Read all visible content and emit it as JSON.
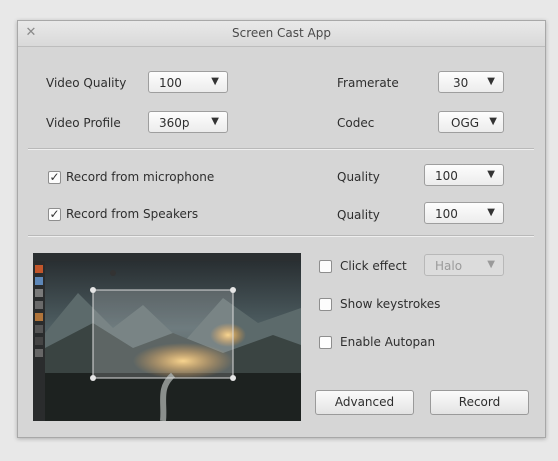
{
  "window": {
    "title": "Screen Cast App"
  },
  "video": {
    "quality_label": "Video Quality",
    "quality_value": "100",
    "profile_label": "Video Profile",
    "profile_value": "360p",
    "framerate_label": "Framerate",
    "framerate_value": "30",
    "codec_label": "Codec",
    "codec_value": "OGG"
  },
  "audio": {
    "mic_label": "Record from microphone",
    "mic_checked": true,
    "mic_quality_label": "Quality",
    "mic_quality_value": "100",
    "speakers_label": "Record from Speakers",
    "speakers_checked": true,
    "speakers_quality_label": "Quality",
    "speakers_quality_value": "100"
  },
  "options": {
    "click_effect_label": "Click effect",
    "click_effect_checked": false,
    "click_effect_value": "Halo",
    "keystrokes_label": "Show keystrokes",
    "keystrokes_checked": false,
    "autopan_label": "Enable Autopan",
    "autopan_checked": false
  },
  "buttons": {
    "advanced": "Advanced",
    "record": "Record"
  },
  "icons": {
    "close": "close-icon",
    "dropdown": "chevron-down-icon",
    "check": "checkmark-icon"
  },
  "glyphs": {
    "close": "✕",
    "arrow": "▼",
    "check": "✓"
  }
}
